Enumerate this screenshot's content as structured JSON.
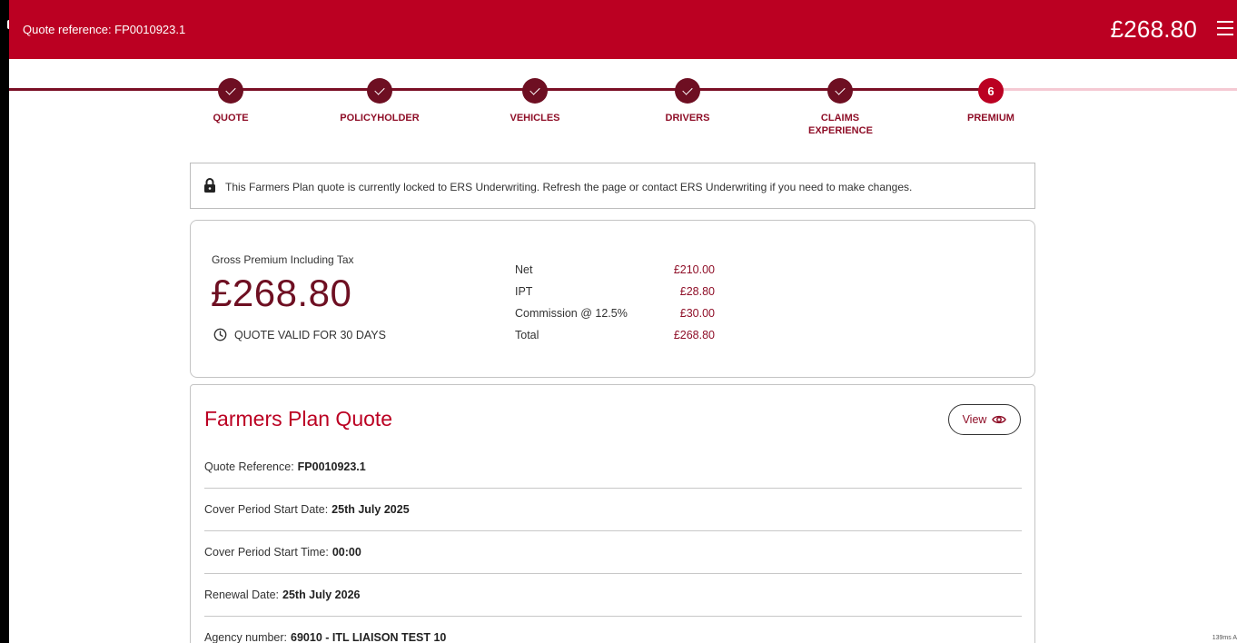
{
  "header": {
    "quote_reference": "Quote reference: FP0010923.1",
    "price": "£268.80"
  },
  "steps": [
    {
      "label": "QUOTE",
      "state": "complete"
    },
    {
      "label": "POLICYHOLDER",
      "state": "complete"
    },
    {
      "label": "VEHICLES",
      "state": "complete"
    },
    {
      "label": "DRIVERS",
      "state": "complete"
    },
    {
      "label": "CLAIMS EXPERIENCE",
      "state": "complete"
    },
    {
      "label": "PREMIUM",
      "state": "active",
      "number": "6"
    }
  ],
  "lock_notice": "This Farmers Plan quote is currently locked to ERS Underwriting. Refresh the page or contact ERS Underwriting if you need to make changes.",
  "premium": {
    "gross_label": "Gross Premium Including Tax",
    "gross_amount": "£268.80",
    "validity": "QUOTE VALID FOR 30 DAYS",
    "breakdown": [
      {
        "label": "Net",
        "value": "£210.00"
      },
      {
        "label": "IPT",
        "value": "£28.80"
      },
      {
        "label": "Commission @ 12.5%",
        "value": "£30.00"
      },
      {
        "label": "Total",
        "value": "£268.80"
      }
    ]
  },
  "quote_card": {
    "title": "Farmers Plan Quote",
    "view_label": "View",
    "details": [
      {
        "label": "Quote Reference:",
        "value": "FP0010923.1"
      },
      {
        "label": "Cover Period Start Date:",
        "value": "25th July 2025"
      },
      {
        "label": "Cover Period Start Time:",
        "value": "00:00"
      },
      {
        "label": "Renewal Date:",
        "value": "25th July 2026"
      },
      {
        "label": "Agency number:",
        "value": "69010 - ITL LIAISON TEST 10"
      }
    ]
  },
  "corner_note": "139ms A",
  "colors": {
    "brand_red": "#bb0022",
    "dark_maroon": "#6e0f22",
    "progress_todo": "#f5c9d3"
  },
  "icons": [
    "check-icon",
    "lock-icon",
    "clock-icon",
    "eye-icon",
    "menu-icon"
  ]
}
